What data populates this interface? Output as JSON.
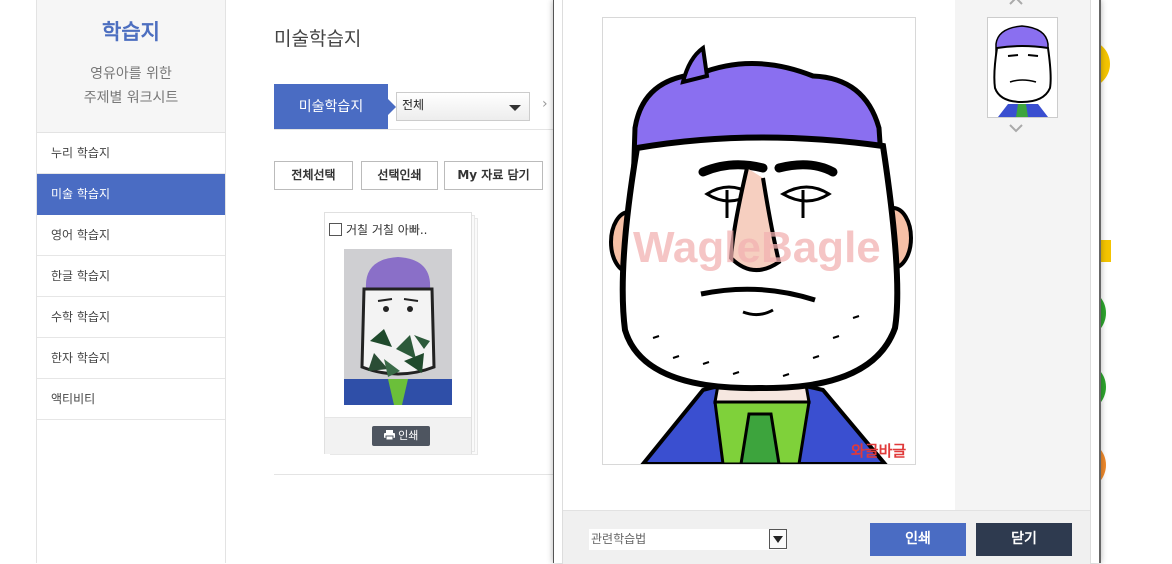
{
  "sidebar": {
    "title": "학습지",
    "subtitle_line1": "영유아를 위한",
    "subtitle_line2": "주제별 워크시트",
    "items": [
      {
        "label": "누리 학습지"
      },
      {
        "label": "미술 학습지"
      },
      {
        "label": "영어 학습지"
      },
      {
        "label": "한글 학습지"
      },
      {
        "label": "수학 학습지"
      },
      {
        "label": "한자 학습지"
      },
      {
        "label": "액티비티"
      }
    ],
    "active_index": 1
  },
  "main": {
    "page_title": "미술학습지",
    "category_tab": "미술학습지",
    "filter_select": "전체",
    "buttons": {
      "select_all": "전체선택",
      "print_selected": "선택인쇄",
      "my_save": "My 자료 담기"
    },
    "card": {
      "title": "거칠 거칠 아빠..",
      "print_label": "인쇄"
    }
  },
  "modal": {
    "watermark": "WagleBagle",
    "logo": "와글바글",
    "related_select": "관련학습법",
    "print_button": "인쇄",
    "close_button": "닫기"
  },
  "colors": {
    "accent": "#4a6cc3",
    "close_button": "#2e3a4f",
    "deco_yellow": "#f4c400",
    "deco_green": "#2ea52e",
    "deco_orange": "#f08a2c"
  },
  "icons": [
    "chevron-right-icon",
    "dropdown-arrow-icon",
    "printer-icon",
    "chevron-up-icon",
    "chevron-down-icon",
    "checkbox-icon"
  ]
}
